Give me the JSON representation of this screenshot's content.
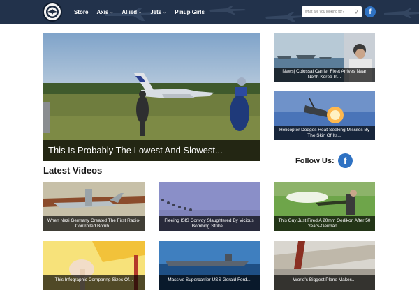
{
  "header": {
    "nav": [
      {
        "label": "Store",
        "has_dropdown": false
      },
      {
        "label": "Axis",
        "has_dropdown": true
      },
      {
        "label": "Allied",
        "has_dropdown": true
      },
      {
        "label": "Jets",
        "has_dropdown": true
      },
      {
        "label": "Pinup Girls",
        "has_dropdown": false
      }
    ],
    "search_placeholder": "what are you looking for?",
    "social_icon": "facebook-icon"
  },
  "hero": {
    "title": "This Is Probably The Lowest And Slowest..."
  },
  "sidebar": {
    "cards": [
      {
        "caption": "News| Colossal Carrier Fleet Arrives Near North Korea In..."
      },
      {
        "caption": "Helicopter Dodges Heat-Seeking Missiles By The Skin Of Its..."
      }
    ],
    "follow_label": "Follow Us:"
  },
  "latest": {
    "title": "Latest Videos",
    "videos": [
      {
        "caption": "When Nazi Germany Created The First Radio-Controlled Bomb..."
      },
      {
        "caption": "Fleeing ISIS Convoy Slaughtered By Vicious Bombing Strike..."
      },
      {
        "caption": "This Guy Just Fired A 20mm Oerlikon After 50 Years-German..."
      },
      {
        "caption": "This Infographic Comparing Sizes Of..."
      },
      {
        "caption": "Massive Supercarrier USS Gerald Ford..."
      },
      {
        "caption": "World's Biggest Plane Makes..."
      }
    ]
  },
  "colors": {
    "header_bg": "#1c2a40",
    "facebook": "#2f72c3",
    "caption_bg": "#000000"
  }
}
